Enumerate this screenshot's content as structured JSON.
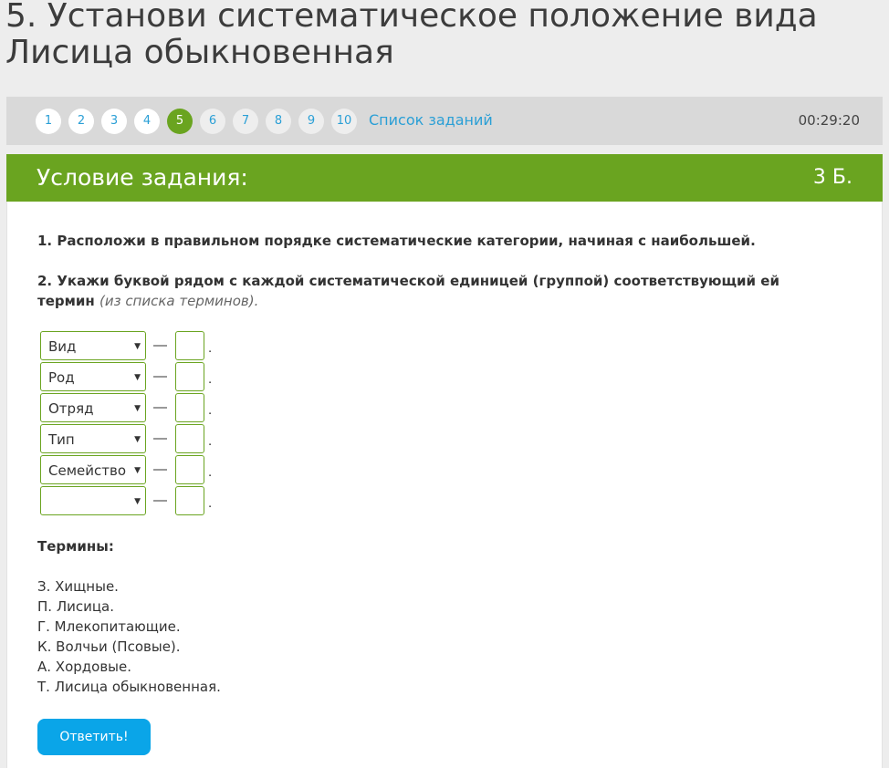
{
  "page_title": "5. Установи систематическое положение вида Лисица обыкновенная",
  "nav": {
    "numbers": [
      "1",
      "2",
      "3",
      "4",
      "5",
      "6",
      "7",
      "8",
      "9",
      "10"
    ],
    "current": "5",
    "tasks_link": "Список заданий",
    "timer": "00:29:20"
  },
  "panel": {
    "title": "Условие задания:",
    "score": "3 Б."
  },
  "instructions": {
    "line1": "1. Расположи в правильном порядке систематические категории, начиная с наибольшей.",
    "line2": "2. Укажи буквой рядом с каждой систематической единицей (группой) соответствующий ей термин ",
    "line2_hint": "(из списка терминов)."
  },
  "rows": [
    {
      "select": "Вид",
      "letter": ""
    },
    {
      "select": "Род",
      "letter": ""
    },
    {
      "select": "Отряд",
      "letter": ""
    },
    {
      "select": "Тип",
      "letter": ""
    },
    {
      "select": "Семейство",
      "letter": ""
    },
    {
      "select": "",
      "letter": ""
    }
  ],
  "symbols": {
    "dash": "—",
    "dot": ".",
    "arrow": "▼"
  },
  "terms_heading": "Термины:",
  "terms": [
    "З. Хищные.",
    "П. Лисица.",
    "Г. Млекопитающие.",
    "К. Волчьи (Псовые).",
    "А. Хордовые.",
    "Т. Лисица обыкновенная."
  ],
  "answer_button": "Ответить!",
  "colors": {
    "accent": "#6aa420",
    "link": "#2a9fd6",
    "button": "#0aa5e8"
  }
}
